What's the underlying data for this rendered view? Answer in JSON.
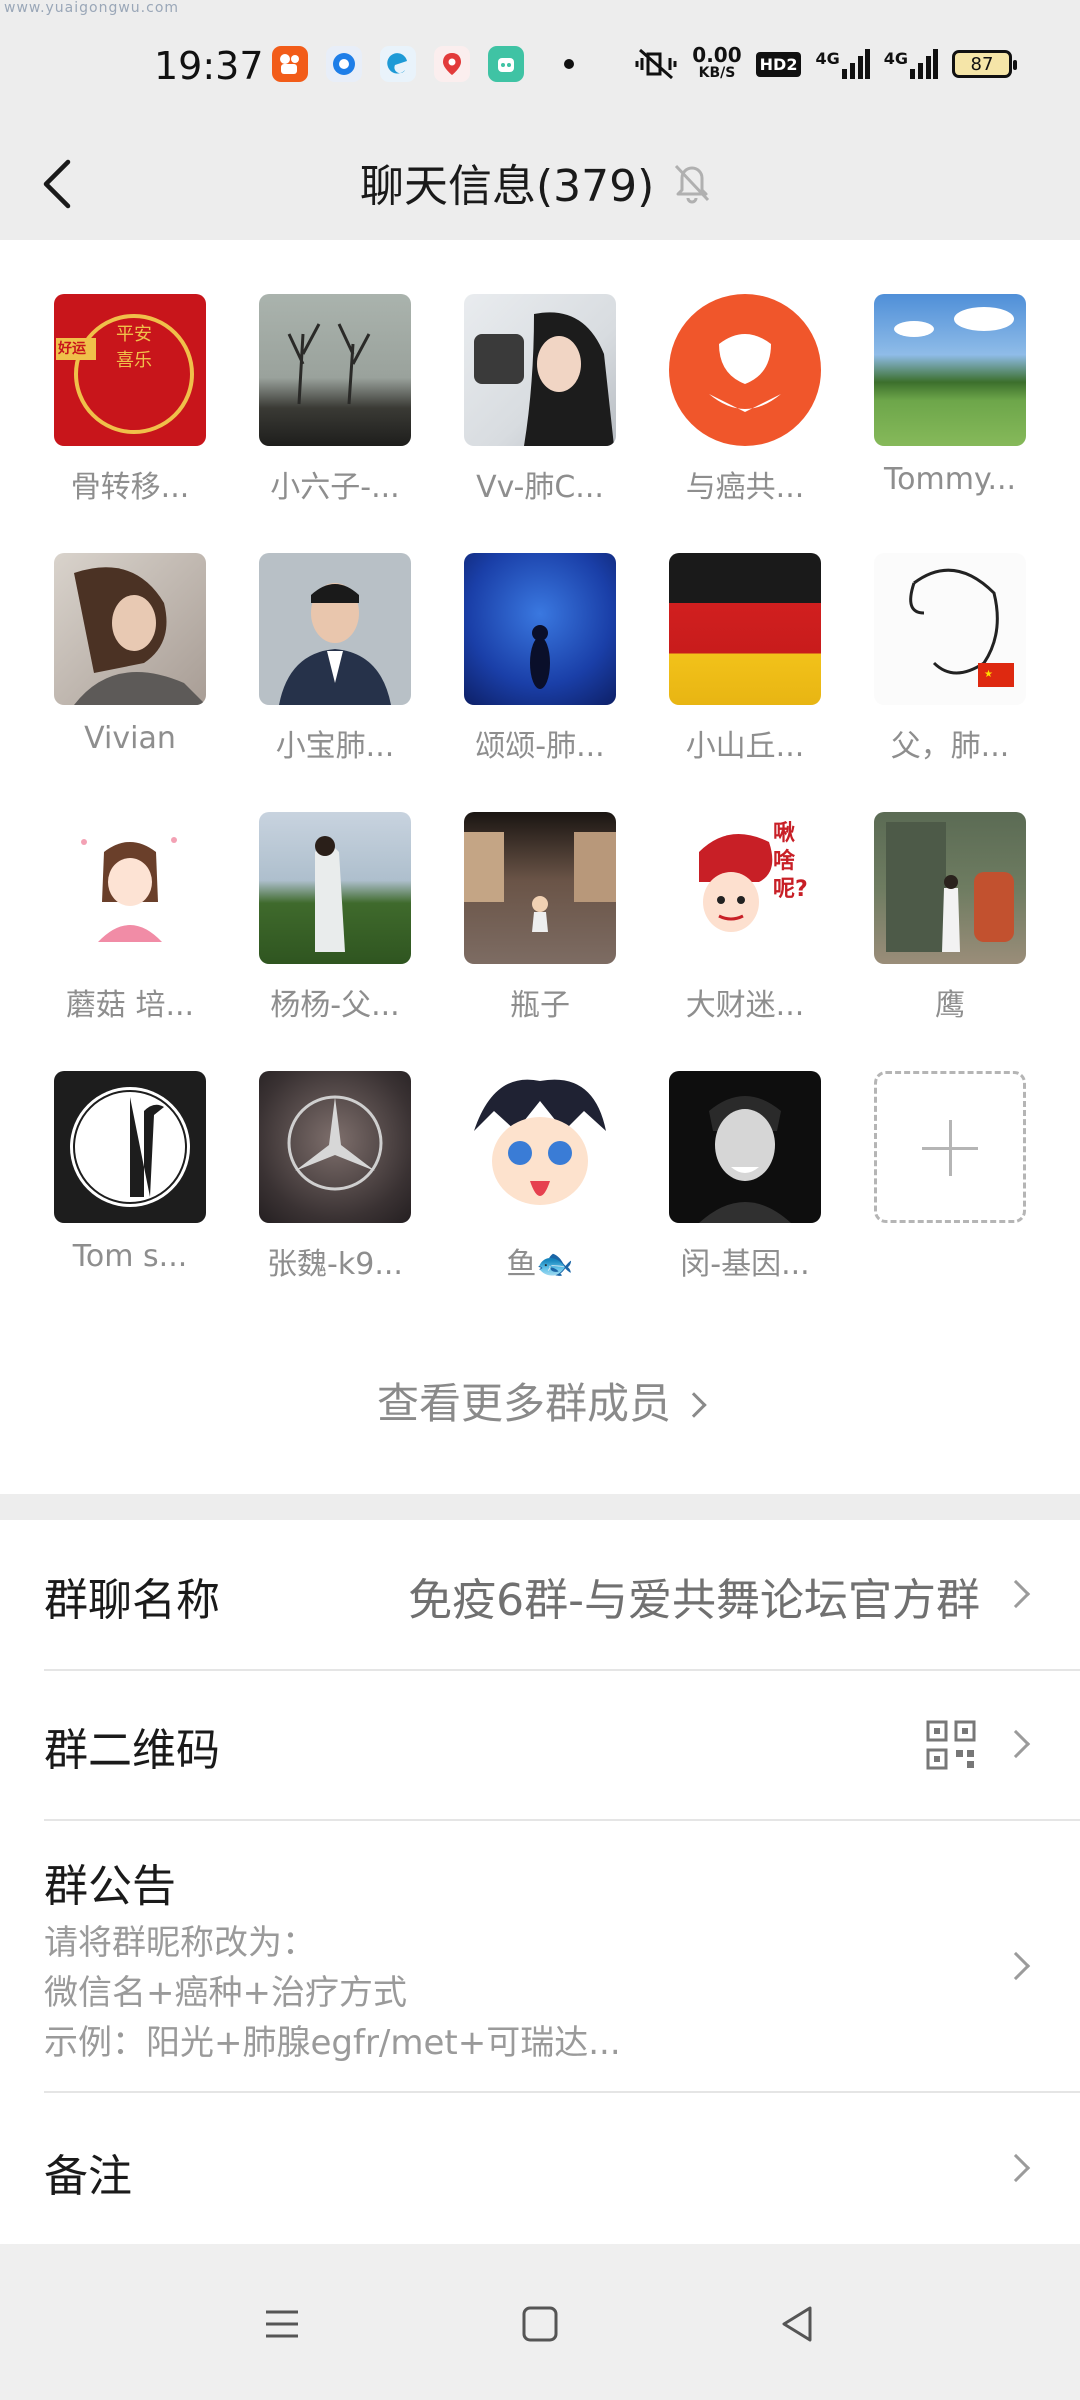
{
  "watermark": "www.yuaigongwu.com",
  "status_bar": {
    "time": "19:37",
    "net_speed_value": "0.00",
    "net_speed_unit": "KB/S",
    "hd_label": "HD2",
    "signal_1": "4G",
    "signal_2": "4G",
    "battery": "87"
  },
  "header": {
    "title": "聊天信息(379)"
  },
  "members": [
    {
      "name": "骨转移..."
    },
    {
      "name": "小六子-..."
    },
    {
      "name": "Vv-肺C..."
    },
    {
      "name": "与癌共..."
    },
    {
      "name": "Tommy..."
    },
    {
      "name": "Vivian"
    },
    {
      "name": "小宝肺..."
    },
    {
      "name": "颂颂-肺..."
    },
    {
      "name": "小山丘..."
    },
    {
      "name": "父，肺..."
    },
    {
      "name": "蘑菇 培..."
    },
    {
      "name": "杨杨-父..."
    },
    {
      "name": "瓶子"
    },
    {
      "name": "大财迷..."
    },
    {
      "name": "鹰"
    },
    {
      "name": "Tom s..."
    },
    {
      "name": "张魏-k9..."
    },
    {
      "name": "鱼🐟"
    },
    {
      "name": "闵-基因..."
    }
  ],
  "avatar_texts": {
    "m1_tag": "好运",
    "m1_blessing": "平安喜乐",
    "m14_bubble": "啾啥呢?"
  },
  "more_members_label": "查看更多群成员",
  "settings": {
    "group_name_label": "群聊名称",
    "group_name_value": "免疫6群-与爱共舞论坛官方群",
    "qr_label": "群二维码",
    "notice_label": "群公告",
    "notice_line1": "请将群昵称改为：",
    "notice_line2": "微信名+癌种+治疗方式",
    "notice_line3": "示例：阳光+肺腺egfr/met+可瑞达...",
    "remark_label": "备注"
  }
}
